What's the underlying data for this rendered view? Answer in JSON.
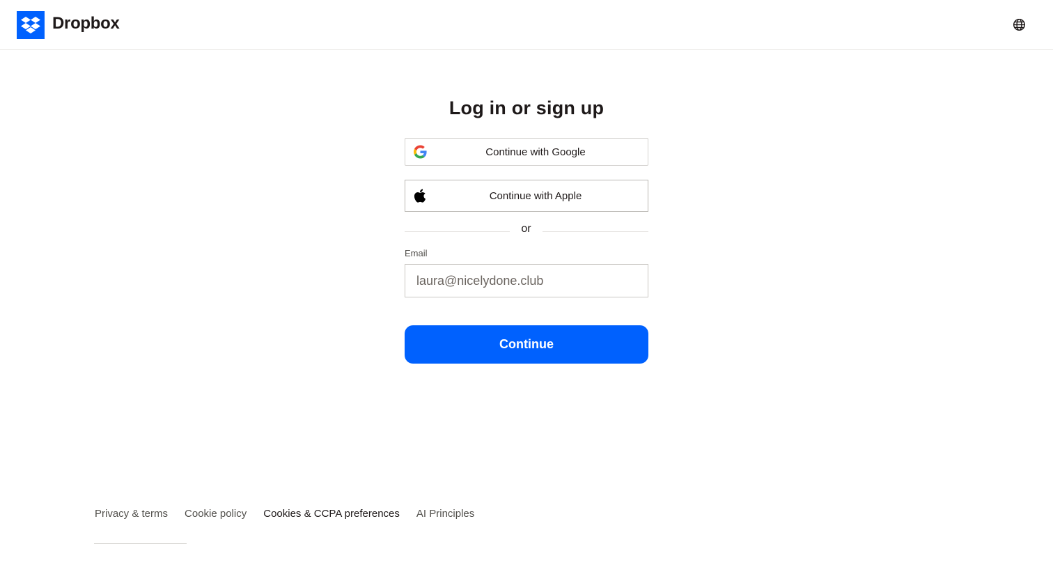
{
  "header": {
    "brand": "Dropbox",
    "logo_icon": "dropbox-logo-icon",
    "language_icon": "globe-icon",
    "brand_color": "#0061fe"
  },
  "main": {
    "title": "Log in or sign up",
    "google_button": {
      "label": "Continue with Google",
      "icon": "google-icon"
    },
    "apple_button": {
      "label": "Continue with Apple",
      "icon": "apple-icon"
    },
    "divider_text": "or",
    "email": {
      "label": "Email",
      "value": "laura@nicelydone.club"
    },
    "continue_button": {
      "label": "Continue",
      "color": "#0061fe"
    }
  },
  "footer": {
    "links": [
      {
        "label": "Privacy & terms"
      },
      {
        "label": "Cookie policy"
      },
      {
        "label": "Cookies & CCPA preferences"
      },
      {
        "label": "AI Principles"
      }
    ]
  }
}
